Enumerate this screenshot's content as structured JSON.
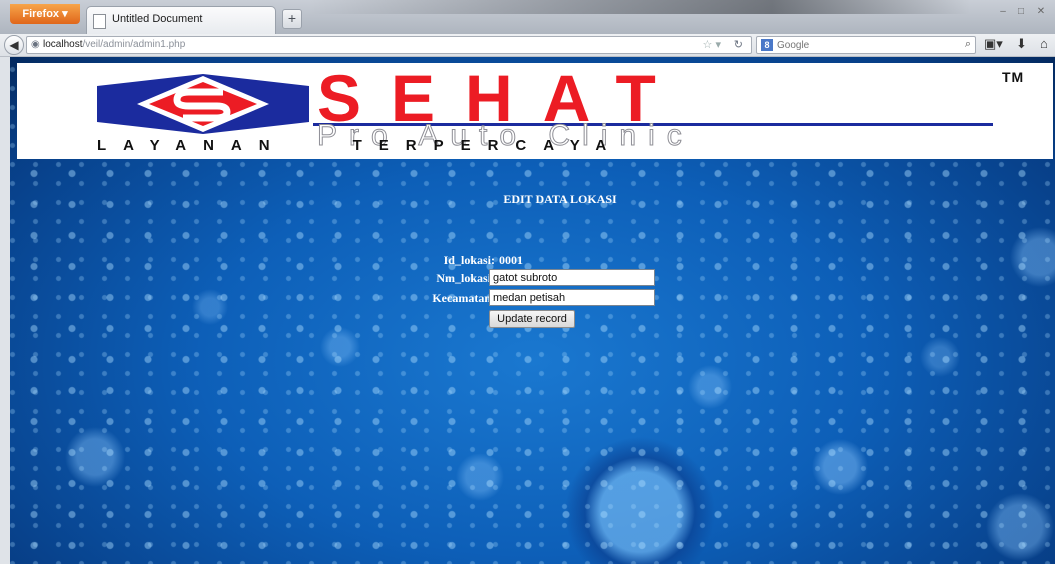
{
  "browser": {
    "menu_button_label": "Firefox ▾",
    "tab_title": "Untitled Document",
    "new_tab_label": "+",
    "url_host": "localhost",
    "url_path": "/veil/admin/admin1.php",
    "search_engine_badge": "8",
    "search_placeholder": "Google",
    "window_controls": [
      "–",
      "□",
      "✕"
    ]
  },
  "banner": {
    "brand": "SEHAT",
    "trademark": "TM",
    "subtitle": "Pro Auto Clinic",
    "tagline_word1": "LAYANAN",
    "tagline_word2": "TERPERCAYA",
    "colors": {
      "brand_red": "#ec1c24",
      "logo_blue": "#1b2b9e"
    }
  },
  "form": {
    "title": "EDIT DATA LOKASI",
    "id_label": "Id_lokasi:",
    "id_value": "0001",
    "nm_label": "Nm_lokasi:",
    "nm_value": "gatot subroto",
    "kec_label": "Kecamatan:",
    "kec_value": "medan petisah",
    "submit_label": "Update record"
  }
}
